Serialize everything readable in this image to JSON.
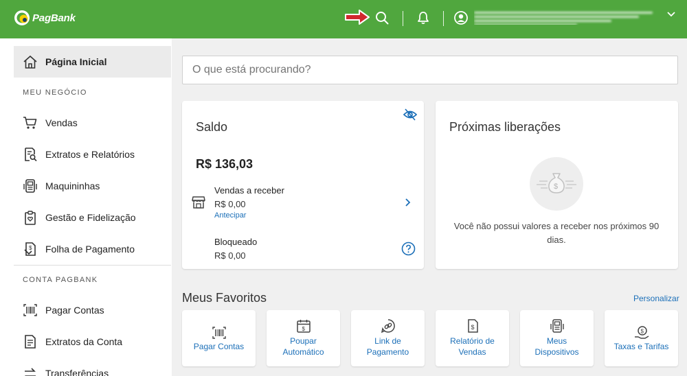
{
  "header": {
    "logo_text": "PagBank",
    "brand_color": "#50a73e",
    "icons": [
      "arrow-annotation",
      "search-icon",
      "bell-icon",
      "user-icon",
      "chevron-down-icon"
    ]
  },
  "sidebar": {
    "items": [
      {
        "label": "Página Inicial",
        "icon": "home-icon"
      },
      {
        "label": "Vendas",
        "icon": "cart-icon"
      },
      {
        "label": "Extratos e Relatórios",
        "icon": "report-icon"
      },
      {
        "label": "Maquininhas",
        "icon": "pos-icon"
      },
      {
        "label": "Gestão e Fidelização",
        "icon": "loyalty-icon"
      },
      {
        "label": "Folha de Pagamento",
        "icon": "payroll-icon"
      },
      {
        "label": "Pagar Contas",
        "icon": "barcode-icon"
      },
      {
        "label": "Extratos da Conta",
        "icon": "statement-icon"
      },
      {
        "label": "Transferências",
        "icon": "transfer-icon"
      }
    ],
    "sections": [
      "MEU NEGÓCIO",
      "CONTA PAGBANK"
    ]
  },
  "search": {
    "placeholder": "O que está procurando?"
  },
  "balance_card": {
    "title": "Saldo",
    "amount": "R$ 136,03",
    "receivable_label": "Vendas a receber",
    "receivable_value": "R$ 0,00",
    "anticipate_link": "Antecipar",
    "blocked_label": "Bloqueado",
    "blocked_value": "R$ 0,00"
  },
  "releases_card": {
    "title": "Próximas liberações",
    "empty_line1": "Você não possui valores a receber nos próximos 90",
    "empty_line2": "dias."
  },
  "favorites": {
    "title": "Meus Favoritos",
    "customize": "Personalizar",
    "items": [
      {
        "line1": "Pagar Contas",
        "line2": "",
        "icon": "barcode-icon"
      },
      {
        "line1": "Poupar",
        "line2": "Automático",
        "icon": "calendar-money-icon"
      },
      {
        "line1": "Link de",
        "line2": "Pagamento",
        "icon": "link-icon"
      },
      {
        "line1": "Relatório de",
        "line2": "Vendas",
        "icon": "report-money-icon"
      },
      {
        "line1": "Meus",
        "line2": "Dispositivos",
        "icon": "device-icon"
      },
      {
        "line1": "Taxas e Tarifas",
        "line2": "",
        "icon": "hand-coin-icon"
      }
    ]
  },
  "colors": {
    "link": "#1b6fb8",
    "annotation_arrow": "#d0282e"
  }
}
